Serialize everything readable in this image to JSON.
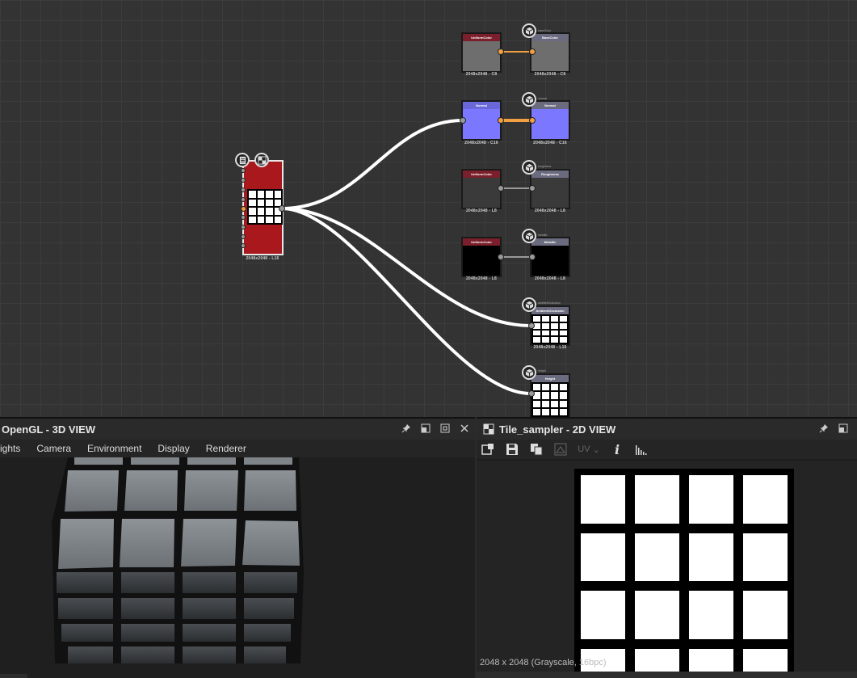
{
  "graph": {
    "source_node": {
      "label": "2048x2048 - L16"
    },
    "output_nodes": [
      {
        "left_header": "UniformColor",
        "right_header": "BaseColor",
        "out_name": "baseColor",
        "left_label": "2048x2048 - C8",
        "right_label": "2048x2048 - C8"
      },
      {
        "left_header": "Normal",
        "right_header": "Normal",
        "out_name": "normal",
        "left_label": "2048x2048 - C16",
        "right_label": "2048x2048 - C16"
      },
      {
        "left_header": "UniformColor",
        "right_header": "Roughness",
        "out_name": "roughness",
        "left_label": "2048x2048 - L8",
        "right_label": "2048x2048 - L8"
      },
      {
        "left_header": "UniformColor",
        "right_header": "Metallic",
        "out_name": "metallic",
        "left_label": "2048x2048 - L8",
        "right_label": "2048x2048 - L8"
      },
      {
        "right_header": "AmbientOcclusion",
        "out_name": "ambientOcclusion",
        "right_label": "2048x2048 - L16"
      },
      {
        "right_header": "Height",
        "out_name": "height"
      }
    ]
  },
  "panel3d": {
    "title": "OpenGL - 3D VIEW",
    "menu": [
      "ights",
      "Camera",
      "Environment",
      "Display",
      "Renderer"
    ]
  },
  "panel2d": {
    "title": "Tile_sampler - 2D VIEW",
    "uv_label": "UV",
    "status": "2048 x 2048 (Grayscale, 16bpc)"
  },
  "colors": {
    "source_node": "#a8181c",
    "normal_node": "#7b78ff",
    "uniform_header": "#7a1f2b",
    "output_header": "#6b6b80",
    "wire": "#ffffff",
    "orange_wire": "#f0a040"
  }
}
